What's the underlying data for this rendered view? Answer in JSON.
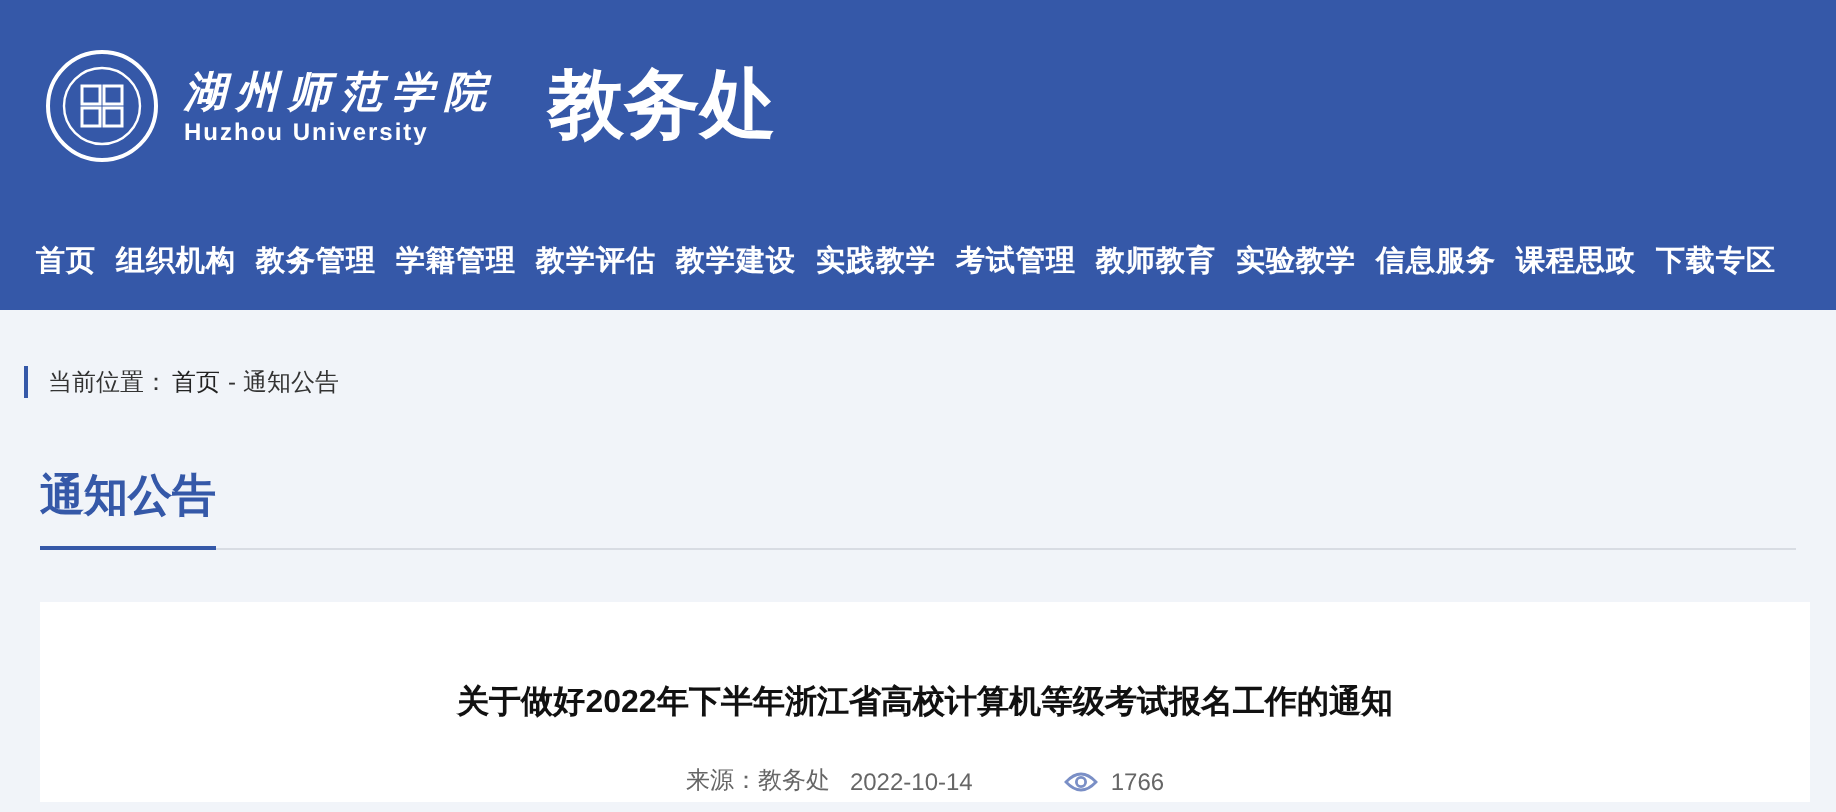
{
  "header": {
    "logo_name": "湖州师范学院",
    "logo_subtitle": "Huzhou University",
    "site_title": "教务处"
  },
  "nav": [
    {
      "label": "首页"
    },
    {
      "label": "组织机构"
    },
    {
      "label": "教务管理"
    },
    {
      "label": "学籍管理"
    },
    {
      "label": "教学评估"
    },
    {
      "label": "教学建设"
    },
    {
      "label": "实践教学"
    },
    {
      "label": "考试管理"
    },
    {
      "label": "教师教育"
    },
    {
      "label": "实验教学"
    },
    {
      "label": "信息服务"
    },
    {
      "label": "课程思政"
    },
    {
      "label": "下载专区"
    }
  ],
  "breadcrumb": {
    "label": "当前位置：",
    "home": "首页",
    "current": " - 通知公告"
  },
  "section_title": "通知公告",
  "article": {
    "title": "关于做好2022年下半年浙江省高校计算机等级考试报名工作的通知",
    "source": "来源：教务处",
    "date": "2022-10-14",
    "views": "1766"
  }
}
